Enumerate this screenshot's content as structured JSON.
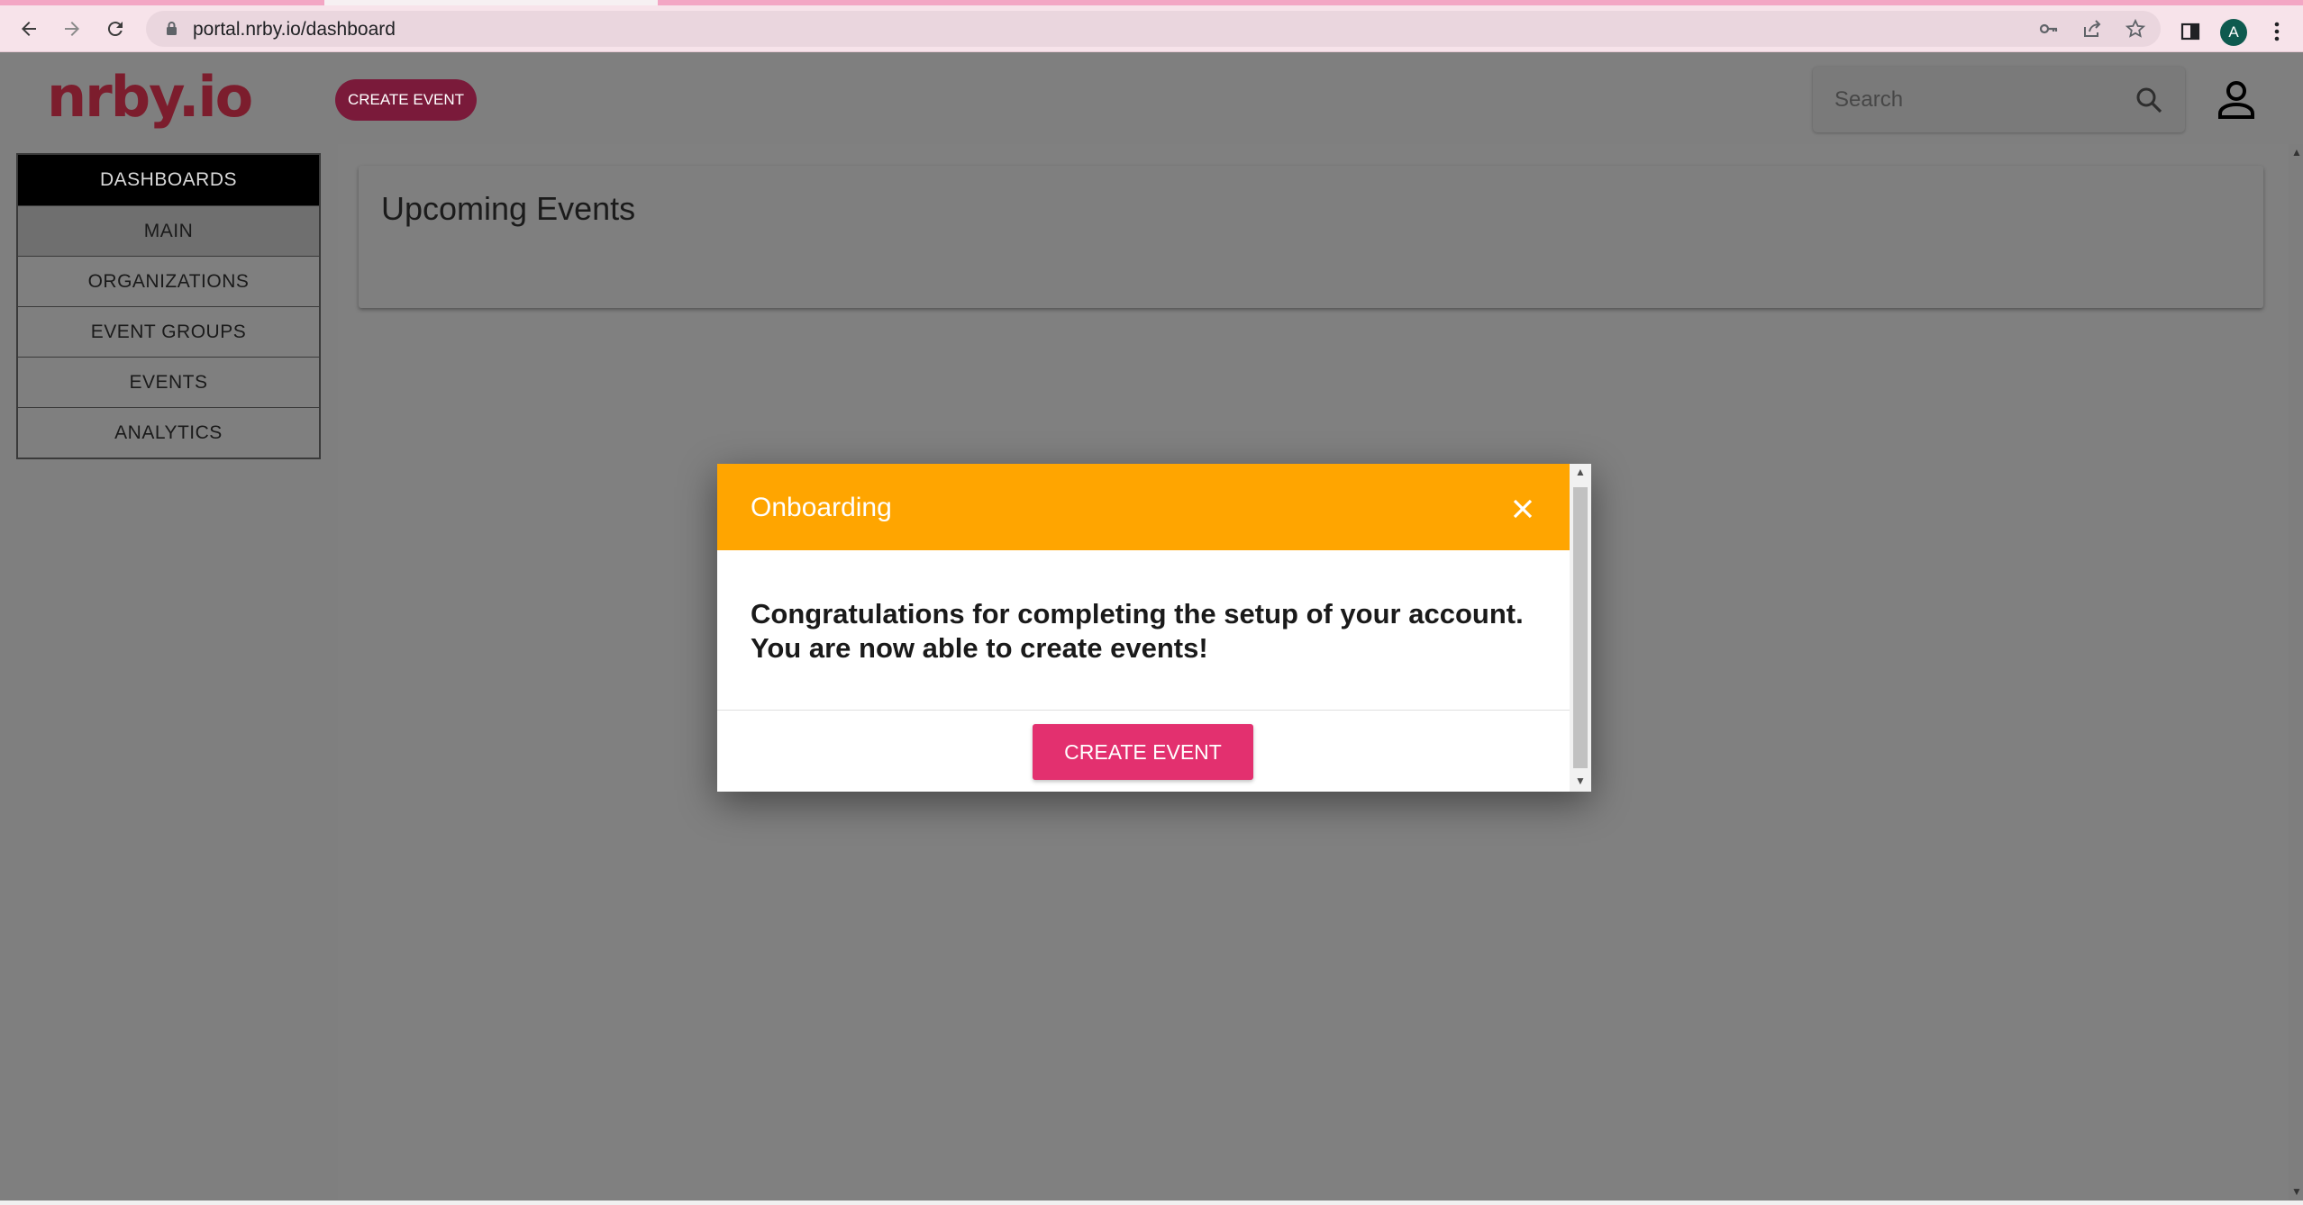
{
  "browser": {
    "url": "portal.nrby.io/dashboard",
    "profile_initial": "A",
    "icons": [
      "back-arrow-icon",
      "forward-arrow-icon",
      "reload-icon",
      "lock-icon",
      "key-icon",
      "share-icon",
      "star-icon",
      "side-panel-icon",
      "more-vert-icon"
    ]
  },
  "header": {
    "logo_text": "nrby.io",
    "create_event_label": "CREATE EVENT",
    "search_placeholder": "Search"
  },
  "sidebar": {
    "items": [
      {
        "label": "DASHBOARDS",
        "state": "header"
      },
      {
        "label": "MAIN",
        "state": "active"
      },
      {
        "label": "ORGANIZATIONS",
        "state": "normal"
      },
      {
        "label": "EVENT GROUPS",
        "state": "normal"
      },
      {
        "label": "EVENTS",
        "state": "normal"
      },
      {
        "label": "ANALYTICS",
        "state": "normal"
      }
    ]
  },
  "main": {
    "card_title": "Upcoming Events"
  },
  "modal": {
    "title": "Onboarding",
    "message_line1": "Congratulations for completing the setup of your account.",
    "message_line2": "You are now able to create events!",
    "button_label": "CREATE EVENT"
  },
  "colors": {
    "modal_header": "#ffa500",
    "primary_button": "#e3306f",
    "logo": "#7c1d2d",
    "overlay_gray": "#7f7f7f"
  }
}
